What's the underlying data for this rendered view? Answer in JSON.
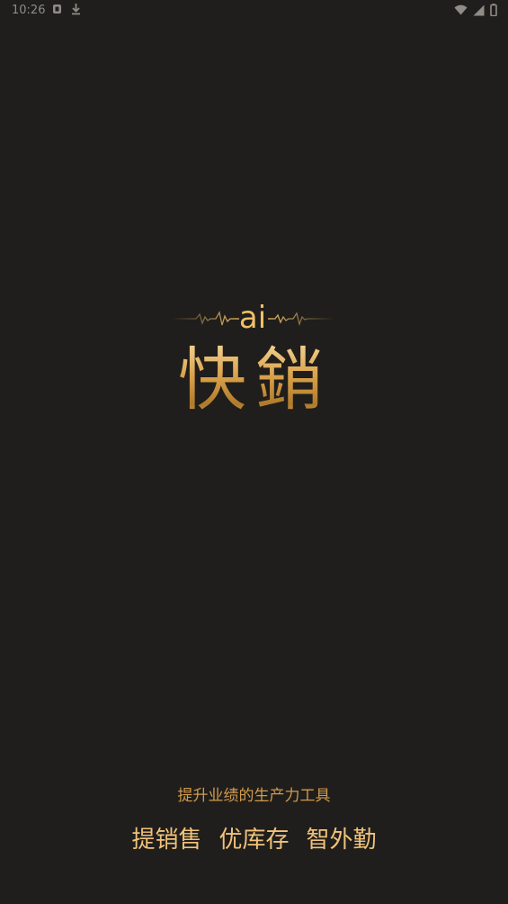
{
  "status_bar": {
    "time": "10:26",
    "icons": [
      "notification-icon",
      "download-icon",
      "wifi-icon",
      "signal-icon",
      "battery-icon"
    ]
  },
  "logo": {
    "ai_text": "ai",
    "brand_name": "快銷"
  },
  "tagline": "提升业绩的生产力工具",
  "features": [
    "提销售",
    "优库存",
    "智外勤"
  ],
  "colors": {
    "background": "#1f1e1c",
    "gold": "#efc069",
    "tagline": "#d29a4c"
  }
}
